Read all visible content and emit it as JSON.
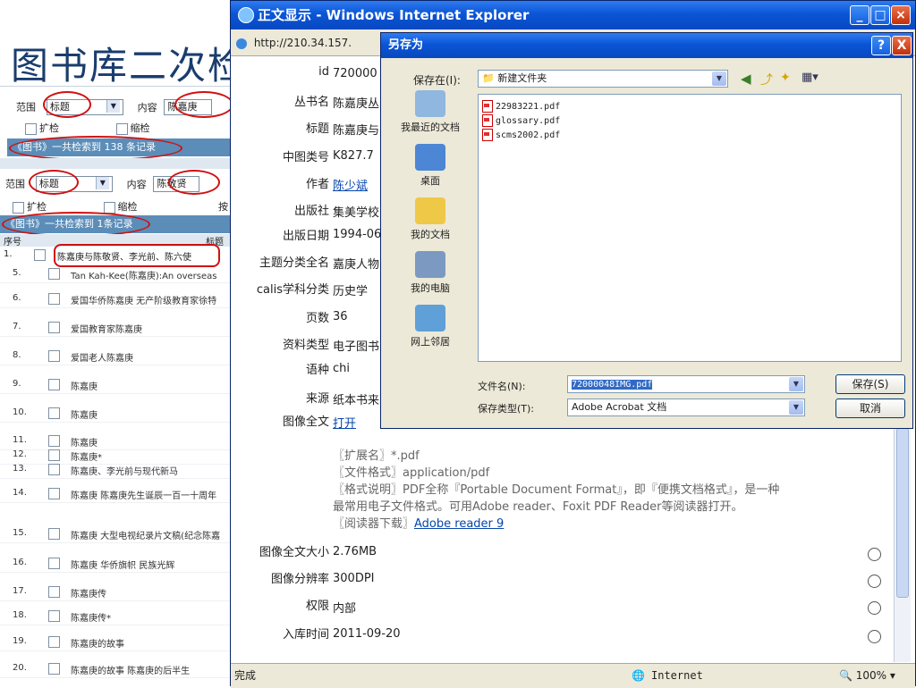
{
  "slide": {
    "title": "图书库二次检"
  },
  "search_panel": {
    "range_label": "范围",
    "range_value": "标题",
    "content_label": "内容",
    "content_value": "陈嘉庚",
    "expand_label": "扩检",
    "narrow_label": "缩检",
    "by_label": "按",
    "result_text": "《图书》一共检索到 138 条记录",
    "col_index": "序号",
    "col_title_partial": "标题",
    "second": {
      "range_label": "范围",
      "range_value": "标题",
      "content_label": "内容",
      "content_value": "陈敬贤",
      "expand_label": "扩检",
      "narrow_label": "缩检",
      "by_label": "按",
      "result_text": "《图书》一共检索到 1条记录",
      "col_index": "序号",
      "col_title": "标题",
      "first_row": {
        "num": "1.",
        "title": "陈嘉庚与陈敬贤、李光前、陈六使"
      }
    },
    "rows": [
      {
        "num": "5.",
        "title": "Tan Kah-Kee(陈嘉庚):An overseas"
      },
      {
        "num": "6.",
        "title": "爱国华侨陈嘉庚 无产阶级教育家徐特"
      },
      {
        "num": "7.",
        "title": "爱国教育家陈嘉庚"
      },
      {
        "num": "8.",
        "title": "爱国老人陈嘉庚"
      },
      {
        "num": "9.",
        "title": "陈嘉庚"
      },
      {
        "num": "10.",
        "title": "陈嘉庚"
      },
      {
        "num": "11.",
        "title": "陈嘉庚"
      },
      {
        "num": "12.",
        "title": "陈嘉庚*"
      },
      {
        "num": "13.",
        "title": "陈嘉庚、李光前与现代新马"
      },
      {
        "num": "14.",
        "title": "陈嘉庚 陈嘉庚先生诞辰一百一十周年"
      },
      {
        "num": "15.",
        "title": "陈嘉庚 大型电视纪录片文稿(纪念陈嘉"
      },
      {
        "num": "16.",
        "title": "陈嘉庚 华侨旗帜 民族光辉"
      },
      {
        "num": "17.",
        "title": "陈嘉庚传"
      },
      {
        "num": "18.",
        "title": "陈嘉庚传*"
      },
      {
        "num": "19.",
        "title": "陈嘉庚的故事"
      },
      {
        "num": "20.",
        "title": "陈嘉庚的故事 陈嘉庚的后半生"
      }
    ]
  },
  "ie_window": {
    "title": "正文显示 - Windows Internet Explorer",
    "address": "http://210.34.157.",
    "fields": [
      {
        "label": "id",
        "value": "720000"
      },
      {
        "label": "丛书名",
        "value": "陈嘉庚丛"
      },
      {
        "label": "标题",
        "value": "陈嘉庚与"
      },
      {
        "label": "中图类号",
        "value": "K827.7"
      },
      {
        "label": "作者",
        "value": "陈少斌"
      },
      {
        "label": "出版社",
        "value": "集美学校"
      },
      {
        "label": "出版日期",
        "value": "1994-06"
      },
      {
        "label": "主题分类全名",
        "value": "嘉庚人物"
      },
      {
        "label": "calis学科分类",
        "value": "历史学"
      },
      {
        "label": "页数",
        "value": "36"
      },
      {
        "label": "资料类型",
        "value": "电子图书"
      },
      {
        "label": "语种",
        "value": "chi"
      },
      {
        "label": "来源",
        "value": "纸本书来"
      },
      {
        "label": "图像全文",
        "value": "打开"
      }
    ],
    "info_lines": [
      "〖扩展名〗*.pdf",
      "〖文件格式〗application/pdf",
      "〖格式说明〗PDF全称『Portable Document Format』，即『便携文档格式』，是一种",
      "最常用电子文件格式。可用Adobe reader、Foxit PDF Reader等阅读器打开。",
      "〖阅读器下载〗"
    ],
    "reader_link": "Adobe reader 9",
    "fields2": [
      {
        "label": "图像全文大小",
        "value": "2.76MB"
      },
      {
        "label": "图像分辨率",
        "value": "300DPI"
      },
      {
        "label": "权限",
        "value": "内部"
      },
      {
        "label": "入库时间",
        "value": "2011-09-20"
      }
    ],
    "status": "完成",
    "zone": "Internet",
    "zoom": "100%"
  },
  "save_dialog": {
    "title": "另存为",
    "save_in_label": "保存在(I):",
    "save_in_value": "新建文件夹",
    "places": [
      "我最近的文档",
      "桌面",
      "我的文档",
      "我的电脑",
      "网上邻居"
    ],
    "files": [
      "22983221.pdf",
      "glossary.pdf",
      "scms2002.pdf"
    ],
    "filename_label": "文件名(N):",
    "filename_value": "72000048IMG.pdf",
    "filetype_label": "保存类型(T):",
    "filetype_value": "Adobe Acrobat 文档",
    "save_button": "保存(S)",
    "cancel_button": "取消",
    "help": "?",
    "close": "X"
  },
  "colors": {
    "titlebar": "#0a55d6",
    "accent_red": "#d01010",
    "bar_blue": "#5b8db8",
    "title_blue": "#1a3d6e"
  }
}
